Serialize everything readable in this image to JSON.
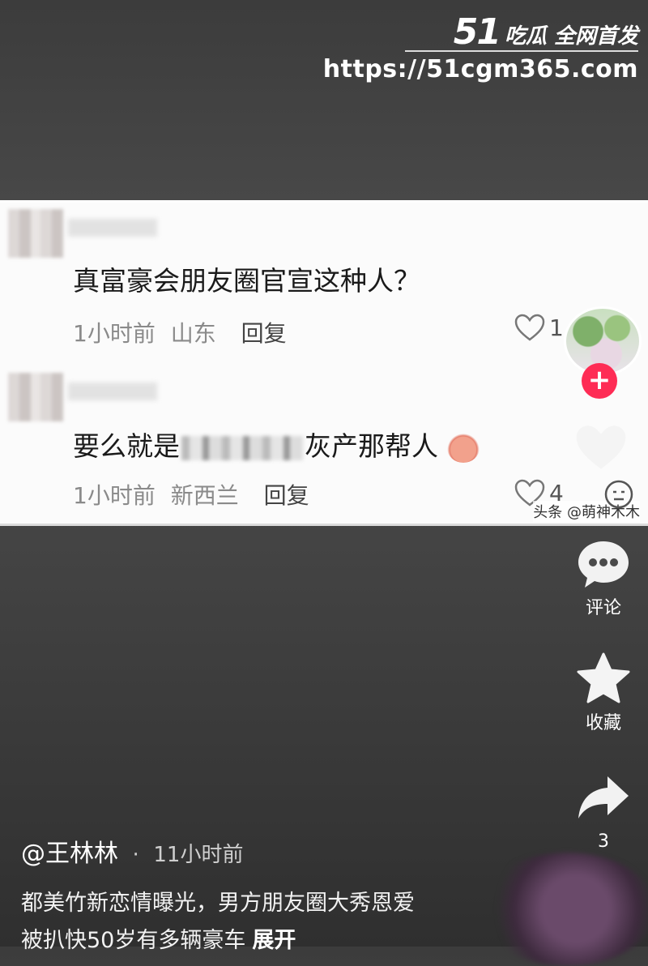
{
  "watermark": {
    "number": "51",
    "tagline": "吃瓜 全网首发",
    "url": "https://51cgm365.com"
  },
  "comments": [
    {
      "text": "真富豪会朋友圈官宣这种人？",
      "time": "1小时前",
      "location": "山东",
      "reply_label": "回复",
      "likes": "1"
    },
    {
      "text_before": "要么就是",
      "text_after": "灰产那帮人",
      "time": "1小时前",
      "location": "新西兰",
      "reply_label": "回复",
      "likes": "4"
    }
  ],
  "credit": "头条 @萌神木木",
  "rail": {
    "comment_label": "评论",
    "collect_label": "收藏",
    "share_count": "3"
  },
  "post": {
    "author": "@王林林",
    "separator": "·",
    "time": "11小时前",
    "caption_line1": "都美竹新恋情曝光，男方朋友圈大秀恩爱",
    "caption_line2": "被扒快50岁有多辆豪车",
    "more_label": "展开"
  },
  "colors": {
    "follow_red": "#fe2c55"
  }
}
